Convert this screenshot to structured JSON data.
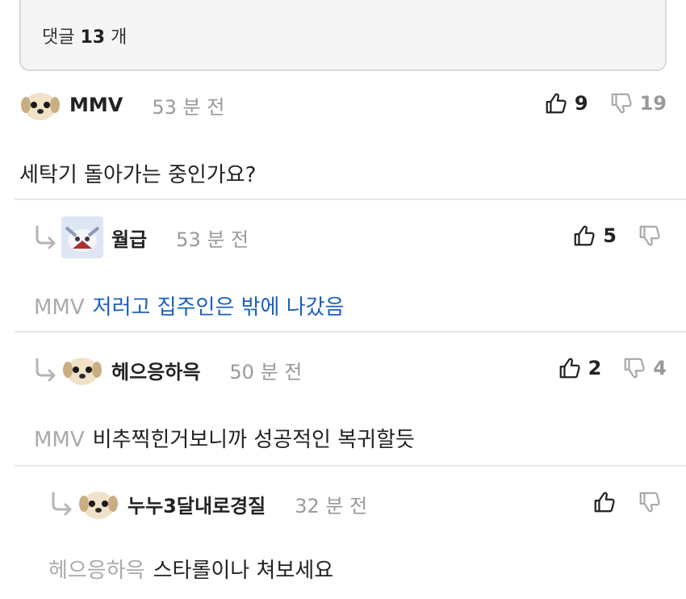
{
  "comment_count": {
    "prefix": "댓글",
    "count": "13",
    "suffix": "개"
  },
  "comments": [
    {
      "nick": "MMV",
      "time": "53 분 전",
      "likes": "9",
      "dislikes": "19",
      "mention": "",
      "text": "세탁기 돌아가는 중인가요?"
    },
    {
      "nick": "월급",
      "time": "53 분 전",
      "likes": "5",
      "dislikes": "",
      "mention": "MMV",
      "text": "저러고 집주인은 밖에 나갔음"
    },
    {
      "nick": "헤으응하윽",
      "time": "50 분 전",
      "likes": "2",
      "dislikes": "4",
      "mention": "MMV",
      "text": "비추찍힌거보니까 성공적인 복귀할듯"
    },
    {
      "nick": "누누3달내로경질",
      "time": "32 분 전",
      "likes": "",
      "dislikes": "",
      "mention": "헤으응하윽",
      "text": "스타롤이나 쳐보세요"
    }
  ],
  "colors": {
    "link_blue": "#1a5fbf",
    "muted": "#999999",
    "divider": "#e8e8e8"
  }
}
